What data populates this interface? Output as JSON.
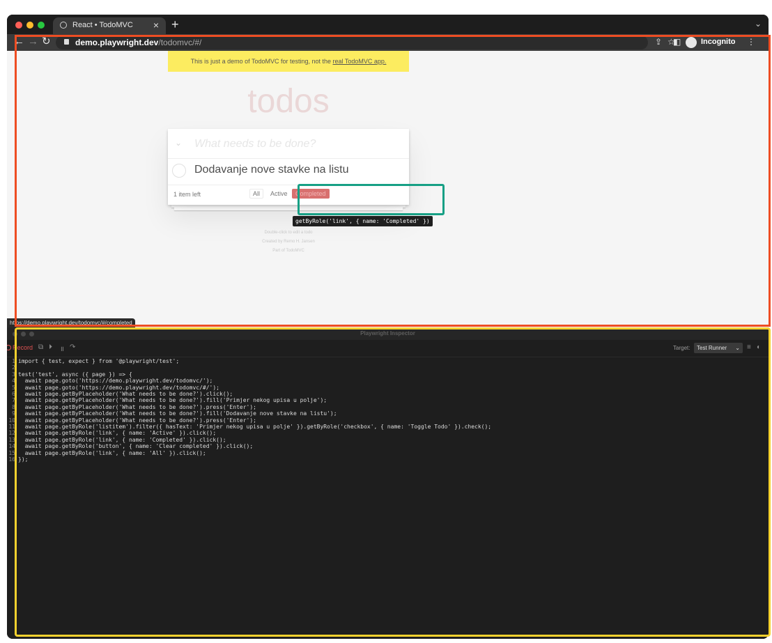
{
  "browser": {
    "tab_title": "React • TodoMVC",
    "tab_close": "×",
    "new_tab": "+",
    "url_host": "demo.playwright.dev",
    "url_path": "/todomvc/#/",
    "incognito_label": "Incognito",
    "status_url": "https://demo.playwright.dev/todomvc/#/completed"
  },
  "page": {
    "banner_text": "This is just a demo of TodoMVC for testing, not the",
    "banner_link": "real TodoMVC app.",
    "app_title": "todos",
    "new_todo_placeholder": "What needs to be done?",
    "todos": [
      {
        "title": "Dodavanje nove stavke na listu",
        "completed": false
      }
    ],
    "items_left": "1 item left",
    "filters": [
      "All",
      "Active",
      "Completed"
    ],
    "selected_filter": "Completed",
    "info_lines": [
      "Double-click to edit a todo",
      "Created by Remo H. Jansen",
      "Part of TodoMVC"
    ],
    "locator_tooltip": "getByRole('link', { name: 'Completed' })"
  },
  "inspector": {
    "title": "Playwright Inspector",
    "record_label": "Record",
    "target_label": "Target:",
    "target_value": "Test Runner",
    "code_lines": [
      "import { test, expect } from '@playwright/test';",
      "",
      "test('test', async ({ page }) => {",
      "  await page.goto('https://demo.playwright.dev/todomvc/');",
      "  await page.goto('https://demo.playwright.dev/todomvc/#/');",
      "  await page.getByPlaceholder('What needs to be done?').click();",
      "  await page.getByPlaceholder('What needs to be done?').fill('Primjer nekog upisa u polje');",
      "  await page.getByPlaceholder('What needs to be done?').press('Enter');",
      "  await page.getByPlaceholder('What needs to be done?').fill('Dodavanje nove stavke na listu');",
      "  await page.getByPlaceholder('What needs to be done?').press('Enter');",
      "  await page.getByRole('listitem').filter({ hasText: 'Primjer nekog upisa u polje' }).getByRole('checkbox', { name: 'Toggle Todo' }).check();",
      "  await page.getByRole('link', { name: 'Active' }).click();",
      "  await page.getByRole('link', { name: 'Completed' }).click();",
      "  await page.getByRole('button', { name: 'Clear completed' }).click();",
      "  await page.getByRole('link', { name: 'All' }).click();",
      "});"
    ]
  },
  "colors": {
    "highlight_browser": "#ee4d23",
    "highlight_inspector": "#f5d12e",
    "highlight_locator": "#17a085",
    "banner_bg": "#fcec60",
    "completed_filter": "#d8706f"
  }
}
